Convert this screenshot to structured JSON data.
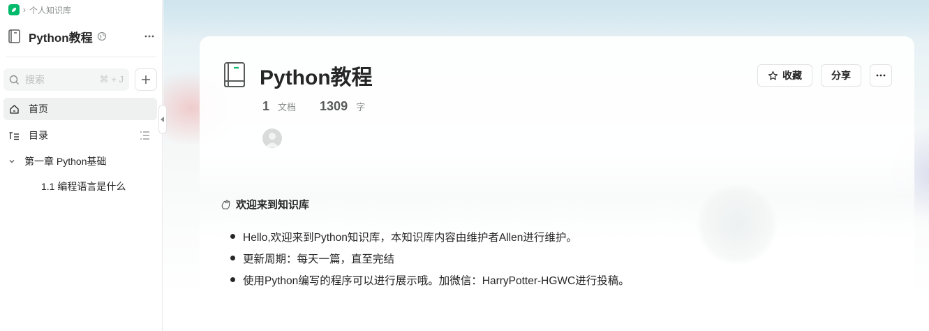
{
  "breadcrumb": {
    "space": "个人知识库"
  },
  "sidebar": {
    "book_title": "Python教程",
    "search": {
      "placeholder": "搜索",
      "shortcut": "⌘ + J"
    },
    "nav": {
      "home": "首页",
      "toc": "目录"
    },
    "tree": {
      "chapter": "第一章 Python基础",
      "doc": "1.1 编程语言是什么"
    }
  },
  "main": {
    "title": "Python教程",
    "stats": {
      "docs_count": "1",
      "docs_unit": "文档",
      "words_count": "1309",
      "words_unit": "字"
    },
    "actions": {
      "favorite": "收藏",
      "share": "分享"
    },
    "welcome": {
      "heading": "欢迎来到知识库",
      "items": [
        "Hello,欢迎来到Python知识库，本知识库内容由维护者Allen进行维护。",
        "更新周期：每天一篇，直至完结",
        "使用Python编写的程序可以进行展示哦。加微信：HarryPotter-HGWC进行投稿。"
      ]
    }
  },
  "colors": {
    "brand": "#00b96b",
    "text": "#262626",
    "muted": "#8a8f8d"
  }
}
